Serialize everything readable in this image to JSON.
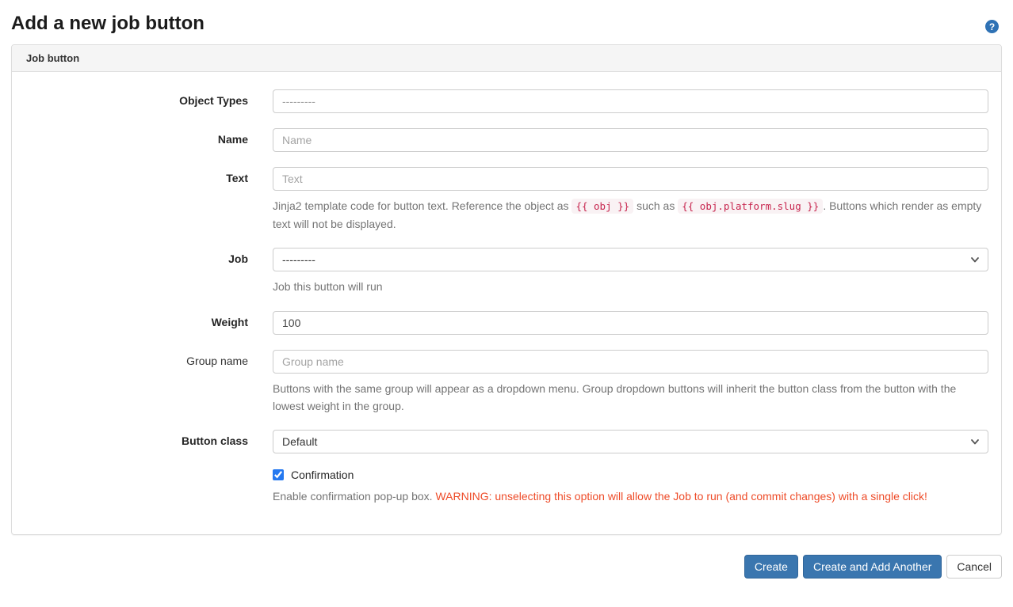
{
  "page": {
    "title": "Add a new job button",
    "help_icon_glyph": "?"
  },
  "panel": {
    "header": "Job button"
  },
  "form": {
    "object_types": {
      "label": "Object Types",
      "placeholder": "---------"
    },
    "name": {
      "label": "Name",
      "placeholder": "Name"
    },
    "text": {
      "label": "Text",
      "placeholder": "Text",
      "help_pre": "Jinja2 template code for button text. Reference the object as ",
      "code1": "{{ obj }}",
      "help_mid": " such as ",
      "code2": "{{ obj.platform.slug }}",
      "help_post": ". Buttons which render as empty text will not be displayed."
    },
    "job": {
      "label": "Job",
      "selected": "---------",
      "help": "Job this button will run"
    },
    "weight": {
      "label": "Weight",
      "value": "100"
    },
    "group_name": {
      "label": "Group name",
      "placeholder": "Group name",
      "help": "Buttons with the same group will appear as a dropdown menu. Group dropdown buttons will inherit the button class from the button with the lowest weight in the group."
    },
    "button_class": {
      "label": "Button class",
      "selected": "Default"
    },
    "confirmation": {
      "label": "Confirmation",
      "checked_attr": "checked",
      "help": "Enable confirmation pop-up box. ",
      "warning": "WARNING: unselecting this option will allow the Job to run (and commit changes) with a single click!"
    }
  },
  "footer": {
    "create": "Create",
    "create_and_add": "Create and Add Another",
    "cancel": "Cancel"
  },
  "colors": {
    "primary_button": "#3a76af",
    "danger_text": "#ee4b28",
    "code_text": "#c7254e",
    "code_background": "#f9f2f4",
    "help_icon_background": "#2f72b5",
    "panel_header_background": "#f5f5f5"
  }
}
